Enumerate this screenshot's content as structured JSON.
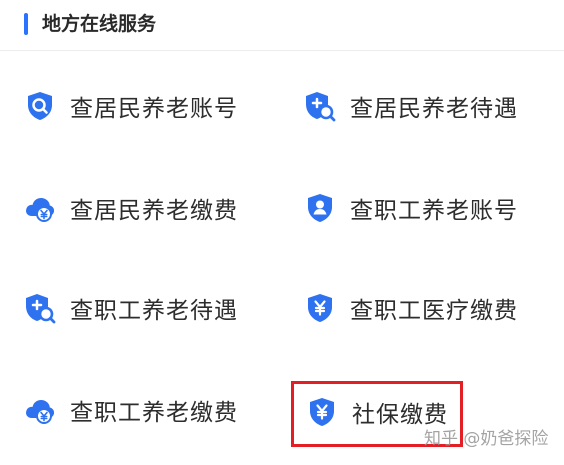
{
  "header": {
    "title": "地方在线服务"
  },
  "services": [
    {
      "label": "查居民养老账号",
      "icon": "shield-search-icon"
    },
    {
      "label": "查居民养老待遇",
      "icon": "shield-plus-search-icon"
    },
    {
      "label": "查居民养老缴费",
      "icon": "cloud-yuan-icon"
    },
    {
      "label": "查职工养老账号",
      "icon": "shield-person-icon"
    },
    {
      "label": "查职工养老待遇",
      "icon": "shield-plus-search-icon"
    },
    {
      "label": "查职工医疗缴费",
      "icon": "shield-yuan-icon"
    },
    {
      "label": "查职工养老缴费",
      "icon": "cloud-yuan-icon"
    },
    {
      "label": "社保缴费",
      "icon": "shield-yuan-icon",
      "highlighted": true
    }
  ],
  "watermark": "知乎 @奶爸探险",
  "colors": {
    "accent": "#2b73ff",
    "icon_blue": "#2f72f0",
    "highlight_red": "#e31e25"
  }
}
